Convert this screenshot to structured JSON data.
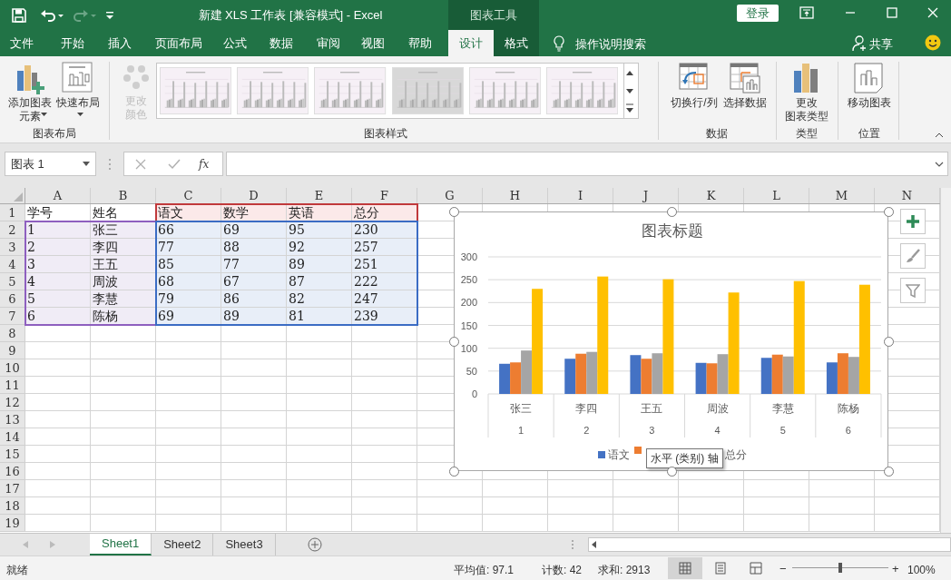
{
  "window": {
    "title": "新建 XLS 工作表  [兼容模式]  -  Excel",
    "context_label": "图表工具",
    "sign_in": "登录"
  },
  "tabs": [
    {
      "label": "文件",
      "selected": false,
      "kind": "normal"
    },
    {
      "label": "开始",
      "selected": false,
      "kind": "normal"
    },
    {
      "label": "插入",
      "selected": false,
      "kind": "normal"
    },
    {
      "label": "页面布局",
      "selected": false,
      "kind": "normal"
    },
    {
      "label": "公式",
      "selected": false,
      "kind": "normal"
    },
    {
      "label": "数据",
      "selected": false,
      "kind": "normal"
    },
    {
      "label": "审阅",
      "selected": false,
      "kind": "normal"
    },
    {
      "label": "视图",
      "selected": false,
      "kind": "normal"
    },
    {
      "label": "帮助",
      "selected": false,
      "kind": "normal"
    },
    {
      "label": "设计",
      "selected": true,
      "kind": "context"
    },
    {
      "label": "格式",
      "selected": false,
      "kind": "context"
    }
  ],
  "tell_me": "操作说明搜索",
  "share": "共享",
  "ribbon": {
    "layout_group": {
      "label": "图表布局",
      "buttons": [
        {
          "label": "添加图表",
          "label2": "元素",
          "kind": "add"
        },
        {
          "label": "快速布局",
          "kind": "layout"
        }
      ]
    },
    "styles_group": {
      "label": "图表样式",
      "change_colors": {
        "label": "更改",
        "label2": "颜色",
        "disabled": true
      },
      "styles": [
        {
          "kind": "light"
        },
        {
          "kind": "light"
        },
        {
          "kind": "light"
        },
        {
          "kind": "gray"
        },
        {
          "kind": "light"
        },
        {
          "kind": "light"
        }
      ]
    },
    "data_group": {
      "label": "数据",
      "buttons": [
        {
          "label": "切换行/列",
          "kind": "switch"
        },
        {
          "label": "选择数据",
          "kind": "select"
        }
      ]
    },
    "type_group": {
      "label": "类型",
      "buttons": [
        {
          "label": "更改",
          "label2": "图表类型",
          "kind": "type"
        }
      ]
    },
    "location_group": {
      "label": "位置",
      "buttons": [
        {
          "label": "移动图表",
          "kind": "move"
        }
      ]
    }
  },
  "formula_bar": {
    "name_box": "图表 1",
    "fx": "fx"
  },
  "sheet": {
    "columns": [
      "A",
      "B",
      "C",
      "D",
      "E",
      "F",
      "G",
      "H",
      "I",
      "J",
      "K",
      "L",
      "M",
      "N"
    ],
    "rows": [
      {
        "number": "1",
        "cells": [
          {
            "text": "学号",
            "kind": "plain"
          },
          {
            "text": "姓名",
            "kind": "plain"
          },
          {
            "text": "语文",
            "kind": "series"
          },
          {
            "text": "数学",
            "kind": "series"
          },
          {
            "text": "英语",
            "kind": "series"
          },
          {
            "text": "总分",
            "kind": "series"
          }
        ]
      },
      {
        "number": "2",
        "cells": [
          {
            "text": "1",
            "kind": "category"
          },
          {
            "text": "张三",
            "kind": "category"
          },
          {
            "text": "66",
            "kind": "values"
          },
          {
            "text": "69",
            "kind": "values"
          },
          {
            "text": "95",
            "kind": "values"
          },
          {
            "text": "230",
            "kind": "values"
          }
        ]
      },
      {
        "number": "3",
        "cells": [
          {
            "text": "2",
            "kind": "category"
          },
          {
            "text": "李四",
            "kind": "category"
          },
          {
            "text": "77",
            "kind": "values"
          },
          {
            "text": "88",
            "kind": "values"
          },
          {
            "text": "92",
            "kind": "values"
          },
          {
            "text": "257",
            "kind": "values"
          }
        ]
      },
      {
        "number": "4",
        "cells": [
          {
            "text": "3",
            "kind": "category"
          },
          {
            "text": "王五",
            "kind": "category"
          },
          {
            "text": "85",
            "kind": "values"
          },
          {
            "text": "77",
            "kind": "values"
          },
          {
            "text": "89",
            "kind": "values"
          },
          {
            "text": "251",
            "kind": "values"
          }
        ]
      },
      {
        "number": "5",
        "cells": [
          {
            "text": "4",
            "kind": "category"
          },
          {
            "text": "周波",
            "kind": "category"
          },
          {
            "text": "68",
            "kind": "values"
          },
          {
            "text": "67",
            "kind": "values"
          },
          {
            "text": "87",
            "kind": "values"
          },
          {
            "text": "222",
            "kind": "values"
          }
        ]
      },
      {
        "number": "6",
        "cells": [
          {
            "text": "5",
            "kind": "category"
          },
          {
            "text": "李慧",
            "kind": "category"
          },
          {
            "text": "79",
            "kind": "values"
          },
          {
            "text": "86",
            "kind": "values"
          },
          {
            "text": "82",
            "kind": "values"
          },
          {
            "text": "247",
            "kind": "values"
          }
        ]
      },
      {
        "number": "7",
        "cells": [
          {
            "text": "6",
            "kind": "category"
          },
          {
            "text": "陈杨",
            "kind": "category"
          },
          {
            "text": "69",
            "kind": "values"
          },
          {
            "text": "89",
            "kind": "values"
          },
          {
            "text": "81",
            "kind": "values"
          },
          {
            "text": "239",
            "kind": "values"
          }
        ]
      },
      {
        "number": "8"
      },
      {
        "number": "9"
      },
      {
        "number": "10"
      },
      {
        "number": "11"
      },
      {
        "number": "12"
      },
      {
        "number": "13"
      },
      {
        "number": "14"
      },
      {
        "number": "15"
      },
      {
        "number": "16"
      },
      {
        "number": "17"
      },
      {
        "number": "18"
      },
      {
        "number": "19"
      }
    ]
  },
  "chart": {
    "chart_data": {
      "type": "bar",
      "title": "图表标题",
      "categories": [
        "张三",
        "李四",
        "王五",
        "周波",
        "李慧",
        "陈杨"
      ],
      "grid": true,
      "series": [
        {
          "name": "语文",
          "color": "#4472c4",
          "values": [
            66,
            77,
            85,
            68,
            79,
            69
          ]
        },
        {
          "color": "#ed7d31",
          "values": [
            69,
            88,
            77,
            67,
            86,
            89
          ]
        },
        {
          "color": "#a5a5a5",
          "values": [
            95,
            92,
            89,
            87,
            82,
            81
          ]
        },
        {
          "name": "总分",
          "color": "#ffc000",
          "values": [
            230,
            257,
            251,
            222,
            247,
            239
          ]
        }
      ],
      "ylim": [
        0,
        300
      ],
      "yticks": [
        0,
        50,
        100,
        150,
        200,
        250,
        300
      ]
    },
    "category_numbers": [
      "1",
      "2",
      "3",
      "4",
      "5",
      "6"
    ],
    "legend": [
      {
        "swatch": true
      },
      {
        "swatch": true
      },
      {
        "swatch": false
      },
      {
        "swatch": false
      }
    ],
    "tooltip": "水平 (类别) 轴"
  },
  "sheet_tabs": [
    {
      "label": "Sheet1",
      "selected": true
    },
    {
      "label": "Sheet2",
      "selected": false
    },
    {
      "label": "Sheet3",
      "selected": false
    }
  ],
  "status_bar": {
    "ready": "就绪",
    "average": "平均值: 97.1",
    "count": "计数: 42",
    "sum": "求和: 2913",
    "views": [
      {
        "kind": "normal",
        "selected": true
      },
      {
        "kind": "page_layout",
        "selected": false
      },
      {
        "kind": "page_break",
        "selected": false
      }
    ],
    "zoom": {
      "level": 0.5,
      "minus": "−",
      "plus": "+",
      "reading": "100%"
    }
  }
}
